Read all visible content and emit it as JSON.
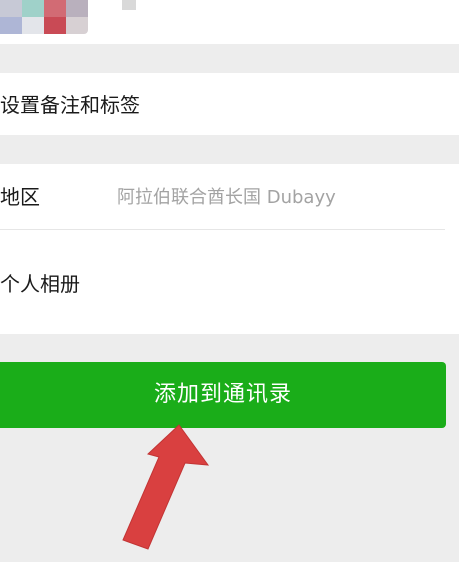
{
  "contact": {
    "remark_row_label": "设置备注和标签",
    "region_label": "地区",
    "region_value": "阿拉伯联合酋长国  Dubayy",
    "album_label": "个人相册"
  },
  "actions": {
    "add_to_contacts_label": "添加到通讯录"
  },
  "colors": {
    "primary_button": "#1aad19",
    "page_background": "#ededed",
    "annotation_arrow": "#d94040"
  },
  "icons": {
    "avatar": "pixelated-avatar",
    "annotation": "arrow-pointer"
  }
}
